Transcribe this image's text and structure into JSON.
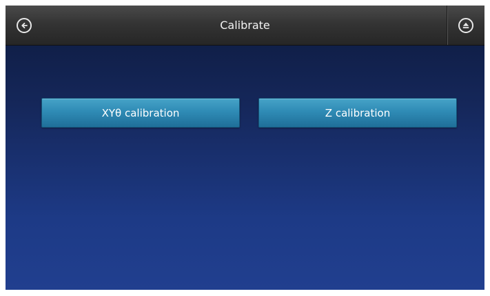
{
  "header": {
    "title": "Calibrate",
    "back_icon": "arrow-left-circle-icon",
    "eject_icon": "eject-circle-icon"
  },
  "buttons": {
    "xy_label": "XYθ calibration",
    "z_label": "Z calibration"
  },
  "colors": {
    "titlebar": "#343434",
    "background_top": "#0d1a3d",
    "background_bottom": "#213f8f",
    "button": "#2f8bb5",
    "text": "#ffffff"
  }
}
